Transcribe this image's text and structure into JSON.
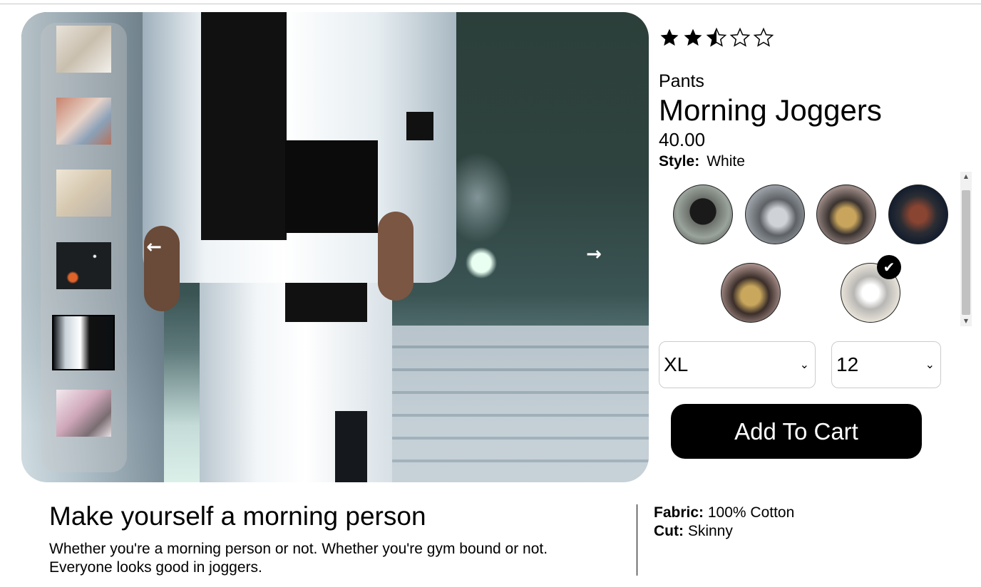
{
  "rating": {
    "value": 2.5,
    "max": 5
  },
  "product": {
    "category": "Pants",
    "name": "Morning Joggers",
    "price": "40.00",
    "style_label": "Style:",
    "style_value": "White"
  },
  "gallery": {
    "thumbnail_count": 6,
    "selected_thumbnail": 5
  },
  "styles": {
    "count": 6,
    "selected": 6,
    "check_icon": "checkmark-icon"
  },
  "selectors": {
    "size": "XL",
    "quantity": "12"
  },
  "cart": {
    "button_label": "Add To Cart"
  },
  "description": {
    "title": "Make yourself a morning person",
    "body": "Whether you're a morning person or not. Whether you're gym bound or not. Everyone looks good in joggers."
  },
  "features": [
    {
      "label": "Fabric:",
      "value": "100% Cotton"
    },
    {
      "label": "Cut:",
      "value": "Skinny"
    }
  ]
}
